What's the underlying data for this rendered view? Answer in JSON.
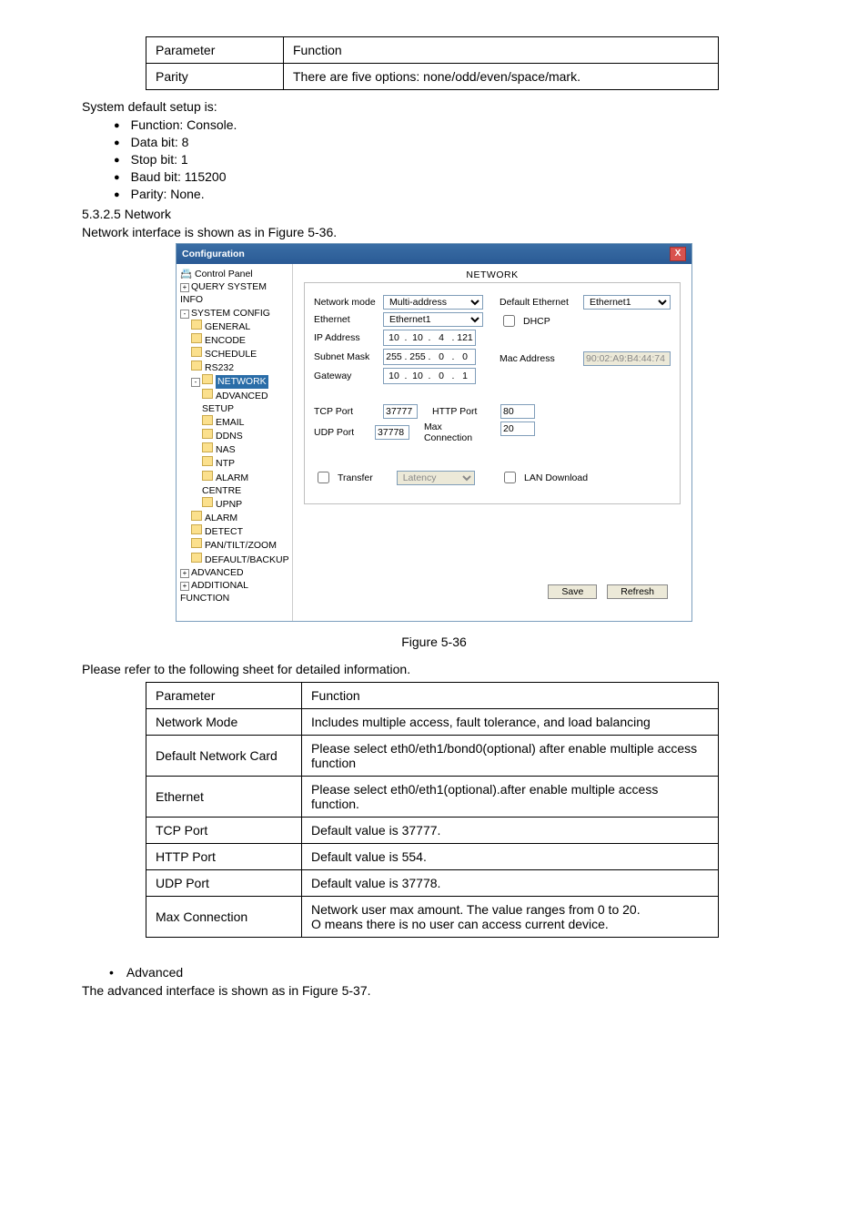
{
  "table1": {
    "h1": "Parameter",
    "h2": "Function",
    "r1c1": "Parity",
    "r1c2": "There are five options: none/odd/even/space/mark."
  },
  "intro1": "System default setup is:",
  "defaults": [
    "Function: Console.",
    "Data bit: 8",
    "Stop bit: 1",
    "Baud bit: 115200",
    "Parity: None."
  ],
  "secnum": "5.3.2.5  Network",
  "secline": "Network interface is shown as in Figure 5-36.",
  "figcap": "Figure 5-36",
  "afterfig": "Please refer to the following sheet for detailed information.",
  "table2": {
    "h1": "Parameter",
    "h2": "Function",
    "rows": [
      [
        "Network Mode",
        "Includes multiple access, fault tolerance, and load balancing"
      ],
      [
        "Default Network Card",
        "Please select eth0/eth1/bond0(optional)  after enable multiple access function"
      ],
      [
        "Ethernet",
        "Please select eth0/eth1(optional).after enable multiple access function."
      ],
      [
        "TCP Port",
        "Default value is 37777."
      ],
      [
        "HTTP  Port",
        "Default value is 554."
      ],
      [
        "UDP Port",
        "Default value is 37778."
      ],
      [
        "Max Connection",
        "Network user max amount. The value ranges from 0 to 20.\nO means there is no user can access current device."
      ]
    ]
  },
  "adv": "Advanced",
  "advline": "The advanced interface is shown as in Figure 5-37.",
  "win": {
    "title": "Configuration",
    "close": "X",
    "tree": {
      "root": "Control Panel",
      "q": "QUERY SYSTEM INFO",
      "s": "SYSTEM CONFIG",
      "items": [
        "GENERAL",
        "ENCODE",
        "SCHEDULE",
        "RS232"
      ],
      "net": "NETWORK",
      "netsub": [
        "ADVANCED SETUP",
        "EMAIL",
        "DDNS",
        "NAS",
        "NTP",
        "ALARM CENTRE",
        "UPNP"
      ],
      "after": [
        "ALARM",
        "DETECT",
        "PAN/TILT/ZOOM",
        "DEFAULT/BACKUP"
      ],
      "adv": "ADVANCED",
      "add": "ADDITIONAL FUNCTION"
    },
    "group": "NETWORK",
    "labels": {
      "nm": "Network mode",
      "eth": "Ethernet",
      "ip": "IP Address",
      "sm": "Subnet Mask",
      "gw": "Gateway",
      "tcp": "TCP Port",
      "udp": "UDP Port",
      "http": "HTTP Port",
      "mc": "Max Connection",
      "de": "Default Ethernet",
      "dhcp": "DHCP",
      "mac": "Mac Address",
      "tr": "Transfer",
      "lat": "Latency",
      "lan": "LAN Download"
    },
    "vals": {
      "nm": "Multi-address",
      "eth": "Ethernet1",
      "de": "Ethernet1",
      "ip": [
        "10",
        "10",
        "4",
        "121"
      ],
      "sm": [
        "255",
        "255",
        "0",
        "0"
      ],
      "gw": [
        "10",
        "10",
        "0",
        "1"
      ],
      "tcp": "37777",
      "udp": "37778",
      "http": "80",
      "mc": "20",
      "mac": "90:02:A9:B4:44:74"
    },
    "btns": {
      "save": "Save",
      "refresh": "Refresh"
    }
  }
}
